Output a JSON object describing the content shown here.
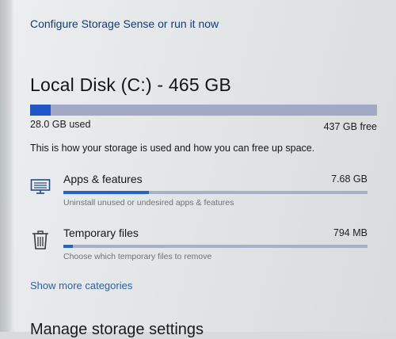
{
  "configure_link": "Configure Storage Sense or run it now",
  "disk": {
    "title": "Local Disk (C:) - 465 GB",
    "used_label": "28.0 GB used",
    "free_label": "437 GB free",
    "used_fraction": 0.06
  },
  "description": "This is how your storage is used and how you can free up space.",
  "categories": [
    {
      "name": "Apps & features",
      "size": "7.68 GB",
      "description": "Uninstall unused or undesired apps & features",
      "icon": "monitor-icon",
      "fill_fraction": 0.28
    },
    {
      "name": "Temporary files",
      "size": "794 MB",
      "description": "Choose which temporary files to remove",
      "icon": "trash-icon",
      "fill_fraction": 0.03
    }
  ],
  "show_more": "Show more categories",
  "next_section_heading": "Manage storage settings",
  "colors": {
    "accent": "#1f56c8",
    "bar_track": "#a3a9c4",
    "link": "#0a3f8c"
  }
}
